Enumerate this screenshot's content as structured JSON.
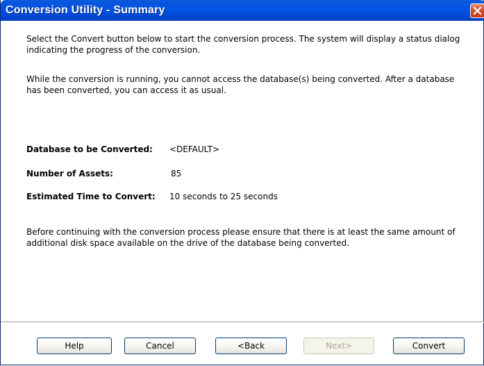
{
  "window": {
    "title": "Conversion Utility - Summary"
  },
  "content": {
    "intro_paragraph": "Select the Convert button below to start the conversion process. The system will display a status dialog indicating the progress of the conversion.",
    "running_paragraph": "While the conversion is running, you cannot access the database(s) being converted. After a database has been converted, you can access it as usual.",
    "fields": [
      {
        "label": "Database to be Converted:",
        "value": "<DEFAULT>"
      },
      {
        "label": "Number of Assets:",
        "value": "85"
      },
      {
        "label": "Estimated Time to Convert:",
        "value": "10 seconds to 25 seconds"
      }
    ],
    "disk_paragraph": "Before continuing with the conversion process please ensure that there is at least the same amount of additional disk space available on the drive of the database being converted."
  },
  "buttons": {
    "help": "Help",
    "cancel": "Cancel",
    "back": "<Back",
    "next": "Next>",
    "convert": "Convert"
  },
  "colors": {
    "titlebar": "#0054e3",
    "close": "#d9532f",
    "button_border": "#003c74"
  },
  "icons": {
    "close": "close-icon"
  }
}
